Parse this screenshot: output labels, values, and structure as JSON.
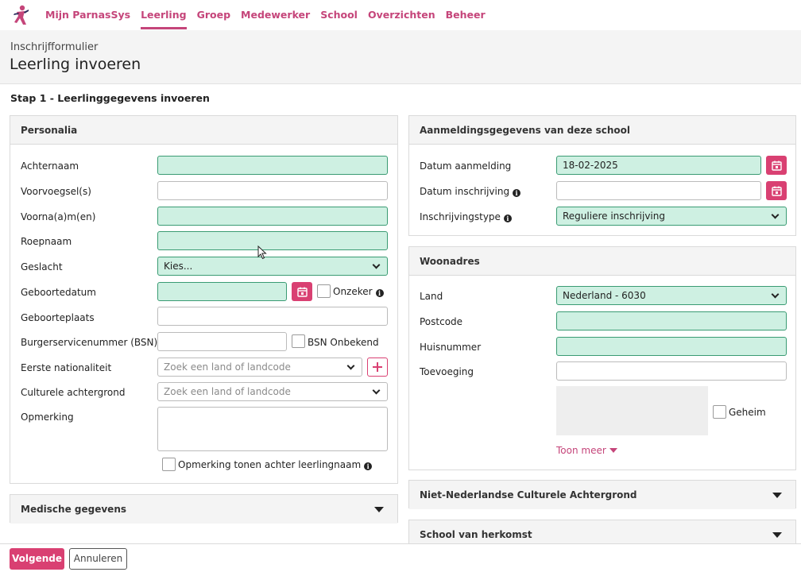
{
  "nav": {
    "items": [
      "Mijn ParnasSys",
      "Leerling",
      "Groep",
      "Medewerker",
      "School",
      "Overzichten",
      "Beheer"
    ],
    "active": "Leerling"
  },
  "header": {
    "subtitle": "Inschrijfformulier",
    "title": "Leerling invoeren"
  },
  "step_title": "Stap 1 - Leerlinggegevens invoeren",
  "personalia": {
    "title": "Personalia",
    "fields": {
      "achternaam": {
        "label": "Achternaam",
        "value": ""
      },
      "voorvoegsel": {
        "label": "Voorvoegsel(s)",
        "value": ""
      },
      "voornamen": {
        "label": "Voorna(a)m(en)",
        "value": ""
      },
      "roepnaam": {
        "label": "Roepnaam",
        "value": ""
      },
      "geslacht": {
        "label": "Geslacht",
        "value": "Kies..."
      },
      "geboortedatum": {
        "label": "Geboortedatum",
        "value": "",
        "checkbox_label": "Onzeker"
      },
      "geboorteplaats": {
        "label": "Geboorteplaats",
        "value": ""
      },
      "bsn": {
        "label": "Burgerservicenummer (BSN)",
        "value": "",
        "checkbox_label": "BSN Onbekend"
      },
      "eerste_nationaliteit": {
        "label": "Eerste nationaliteit",
        "placeholder": "Zoek een land of landcode"
      },
      "culturele_achtergrond": {
        "label": "Culturele achtergrond",
        "placeholder": "Zoek een land of landcode"
      },
      "opmerking": {
        "label": "Opmerking",
        "value": "",
        "checkbox_label": "Opmerking tonen achter leerlingnaam"
      }
    }
  },
  "medische_gegevens": {
    "title": "Medische gegevens"
  },
  "aanmelding": {
    "title": "Aanmeldingsgegevens van deze school",
    "fields": {
      "datum_aanmelding": {
        "label": "Datum aanmelding",
        "value": "18-02-2025"
      },
      "datum_inschrijving": {
        "label": "Datum inschrijving",
        "value": ""
      },
      "inschrijvingstype": {
        "label": "Inschrijvingstype",
        "value": "Reguliere inschrijving"
      }
    }
  },
  "woonadres": {
    "title": "Woonadres",
    "fields": {
      "land": {
        "label": "Land",
        "value": "Nederland - 6030"
      },
      "postcode": {
        "label": "Postcode",
        "value": ""
      },
      "huisnummer": {
        "label": "Huisnummer",
        "value": ""
      },
      "toevoeging": {
        "label": "Toevoeging",
        "value": ""
      }
    },
    "geheim_label": "Geheim",
    "toon_meer": "Toon meer"
  },
  "niet_nl_culturele_achtergrond": {
    "title": "Niet-Nederlandse Culturele Achtergrond"
  },
  "school_van_herkomst": {
    "title": "School van herkomst"
  },
  "footer": {
    "next_label": "Volgende",
    "cancel_label": "Annuleren"
  },
  "colors": {
    "accent": "#d94072",
    "nav_text": "#c5457a",
    "required_bg": "#cef0e2",
    "required_border": "#3a9b73"
  }
}
